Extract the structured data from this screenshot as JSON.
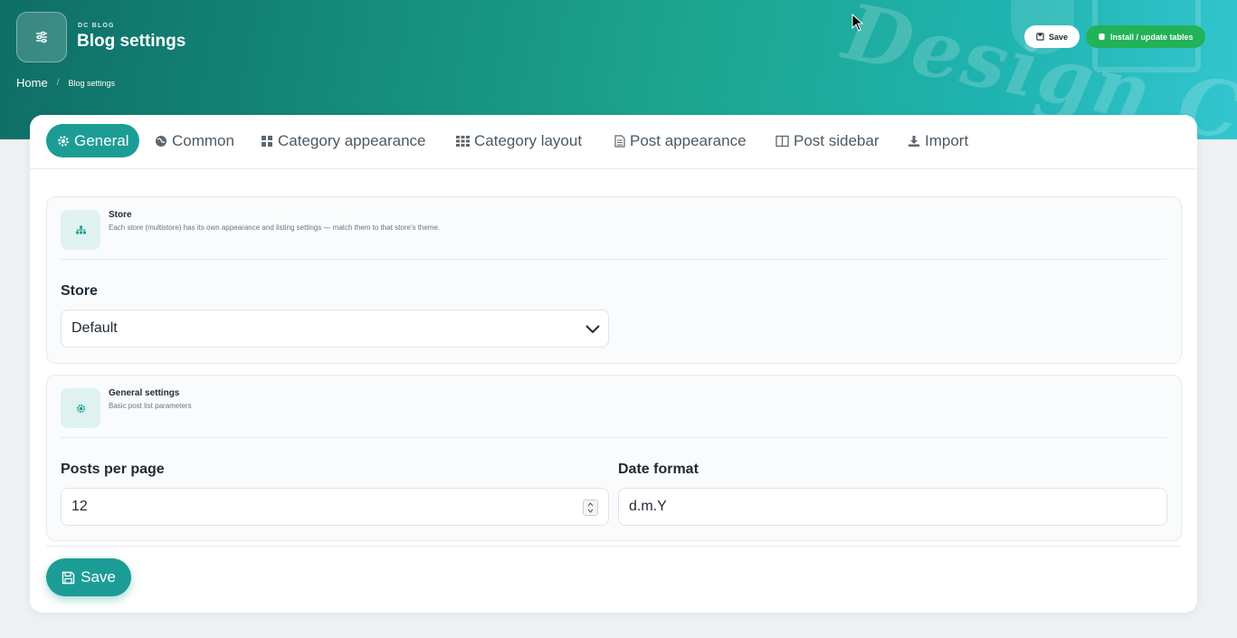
{
  "header": {
    "kicker": "DC BLOG",
    "title": "Blog settings",
    "save_label": "Save",
    "install_label": "Install / update tables",
    "watermark": "Design C"
  },
  "breadcrumb": {
    "home": "Home",
    "separator": "/",
    "current": "Blog settings"
  },
  "tabs": [
    {
      "label": "General",
      "icon": "gear-icon",
      "active": true
    },
    {
      "label": "Common",
      "icon": "globe-icon"
    },
    {
      "label": "Category appearance",
      "icon": "grid-icon"
    },
    {
      "label": "Category layout",
      "icon": "apps-icon"
    },
    {
      "label": "Post appearance",
      "icon": "document-icon"
    },
    {
      "label": "Post sidebar",
      "icon": "columns-icon"
    },
    {
      "label": "Import",
      "icon": "download-icon"
    }
  ],
  "store_section": {
    "title": "Store",
    "subtitle": "Each store (multistore) has its own appearance and listing settings — match them to that store's theme.",
    "field_label": "Store",
    "selected": "Default"
  },
  "general_section": {
    "title": "General settings",
    "subtitle": "Basic post list parameters",
    "posts_per_page_label": "Posts per page",
    "posts_per_page_value": "12",
    "date_format_label": "Date format",
    "date_format_value": "d.m.Y"
  },
  "footer": {
    "save_label": "Save"
  },
  "colors": {
    "accent": "#1b9d96",
    "install": "#22b258"
  }
}
